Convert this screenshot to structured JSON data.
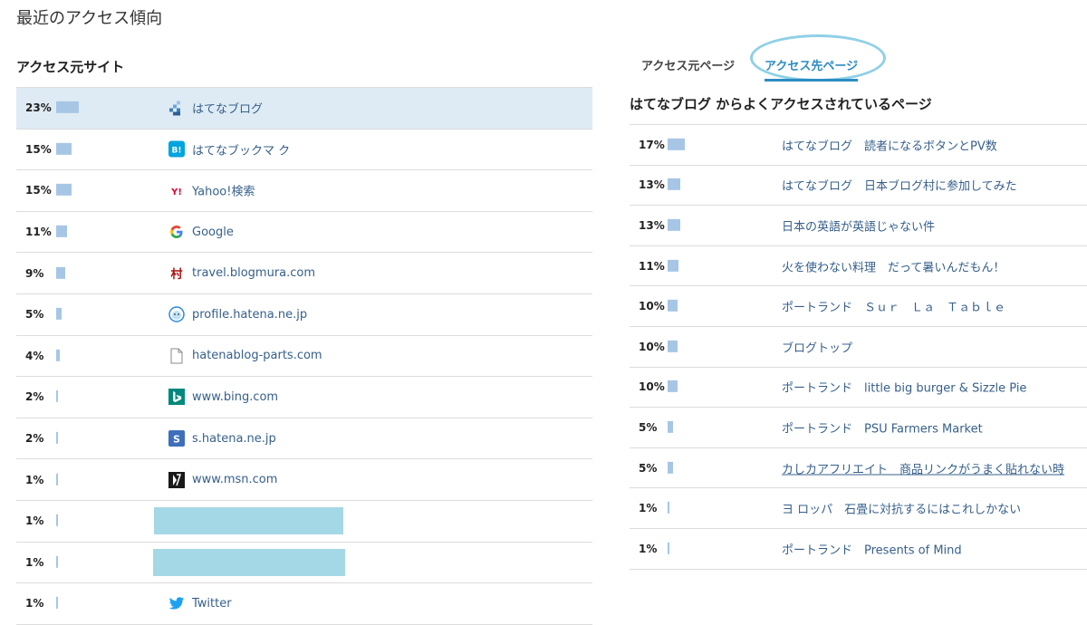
{
  "page_title": "最近のアクセス傾向",
  "left": {
    "title": "アクセス元サイト",
    "rows": [
      {
        "pct": "23%",
        "bar": 0.23,
        "icon": "hatena-blog-icon",
        "label": "はてなブログ",
        "highlight": true
      },
      {
        "pct": "15%",
        "bar": 0.15,
        "icon": "hatena-bookmark-icon",
        "label": "はてなブックマ ク"
      },
      {
        "pct": "15%",
        "bar": 0.15,
        "icon": "yahoo-icon",
        "label": "Yahoo!検索"
      },
      {
        "pct": "11%",
        "bar": 0.11,
        "icon": "google-icon",
        "label": "Google"
      },
      {
        "pct": "9%",
        "bar": 0.09,
        "icon": "blogmura-icon",
        "label": "travel.blogmura.com"
      },
      {
        "pct": "5%",
        "bar": 0.05,
        "icon": "hatena-profile-icon",
        "label": "profile.hatena.ne.jp"
      },
      {
        "pct": "4%",
        "bar": 0.04,
        "icon": "document-icon",
        "label": "hatenablog-parts.com"
      },
      {
        "pct": "2%",
        "bar": 0.02,
        "icon": "bing-icon",
        "label": "www.bing.com"
      },
      {
        "pct": "2%",
        "bar": 0.02,
        "icon": "hatena-s-icon",
        "label": "s.hatena.ne.jp"
      },
      {
        "pct": "1%",
        "bar": 0.01,
        "icon": "msn-icon",
        "label": "www.msn.com"
      },
      {
        "pct": "1%",
        "bar": 0.01,
        "redacted": true
      },
      {
        "pct": "1%",
        "bar": 0.01,
        "redacted": true
      },
      {
        "pct": "1%",
        "bar": 0.01,
        "icon": "twitter-icon",
        "label": "Twitter"
      }
    ]
  },
  "right": {
    "tabs": [
      {
        "label": "アクセス元ページ",
        "active": false
      },
      {
        "label": "アクセス先ページ",
        "active": true
      }
    ],
    "title": "はてなブログ からよくアクセスされているページ",
    "rows": [
      {
        "pct": "17%",
        "bar": 0.17,
        "label": "はてなブログ　読者になるボタンとPV数"
      },
      {
        "pct": "13%",
        "bar": 0.13,
        "label": "はてなブログ　日本ブログ村に参加してみた"
      },
      {
        "pct": "13%",
        "bar": 0.13,
        "label": "日本の英語が英語じゃない件"
      },
      {
        "pct": "11%",
        "bar": 0.11,
        "label": "火を使わない料理　だって暑いんだもん！"
      },
      {
        "pct": "10%",
        "bar": 0.1,
        "label": "ポートランド　Ｓｕｒ　Ｌａ　Ｔａｂｌｅ"
      },
      {
        "pct": "10%",
        "bar": 0.1,
        "label": "ブログトップ"
      },
      {
        "pct": "10%",
        "bar": 0.1,
        "label": "ポートランド　little big burger & Sizzle Pie"
      },
      {
        "pct": "5%",
        "bar": 0.05,
        "label": "ポートランド　PSU Farmers Market"
      },
      {
        "pct": "5%",
        "bar": 0.05,
        "label": "カしカアフリエイト　商品リンクがうまく貼れない時",
        "underline": true
      },
      {
        "pct": "1%",
        "bar": 0.01,
        "label": "ヨ ロッパ　石畳に対抗するにはこれしかない"
      },
      {
        "pct": "1%",
        "bar": 0.01,
        "label": "ポートランド　Presents of Mind"
      }
    ]
  },
  "colors": {
    "bar": "#a7c6e5",
    "link": "#365f8b",
    "accent": "#2d8cc3",
    "highlight": "#deebf4",
    "redact": "#a5d8e6"
  }
}
